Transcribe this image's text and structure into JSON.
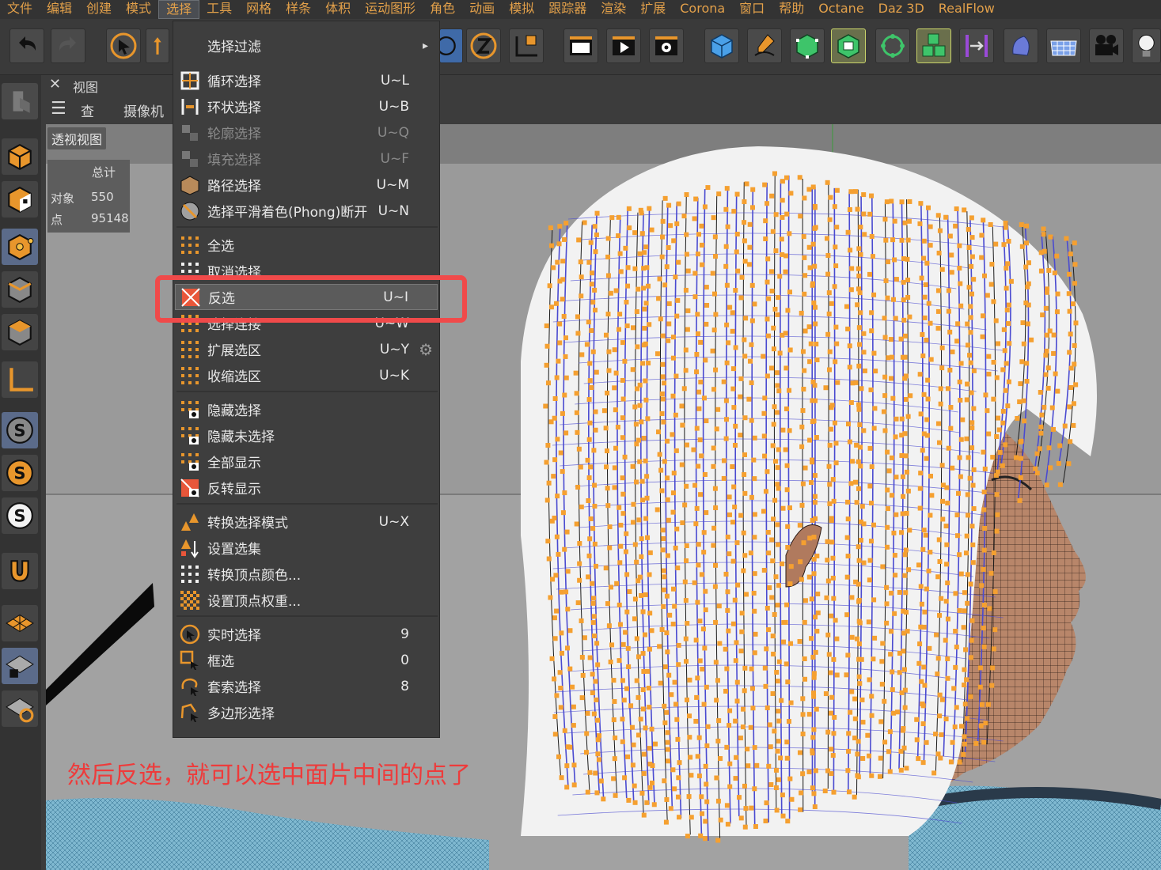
{
  "menubar": {
    "items": [
      "文件",
      "编辑",
      "创建",
      "模式",
      "选择",
      "工具",
      "网格",
      "样条",
      "体积",
      "运动图形",
      "角色",
      "动画",
      "模拟",
      "跟踪器",
      "渲染",
      "扩展",
      "Corona",
      "窗口",
      "帮助",
      "Octane",
      "Daz 3D",
      "RealFlow"
    ],
    "active": "选择"
  },
  "viewport": {
    "panel_title": "视图",
    "menu": [
      "查看",
      "摄像机"
    ],
    "label": "透视视图",
    "stats": {
      "header": "总计",
      "rows": [
        {
          "label": "对象",
          "value": "550"
        },
        {
          "label": "点",
          "value": "95148"
        }
      ]
    }
  },
  "dropdown": {
    "items": [
      {
        "label": "选择过滤",
        "shortcut": "",
        "submenu": true
      },
      {
        "label": "循环选择",
        "shortcut": "U~L"
      },
      {
        "label": "环状选择",
        "shortcut": "U~B"
      },
      {
        "label": "轮廓选择",
        "shortcut": "U~Q",
        "disabled": true
      },
      {
        "label": "填充选择",
        "shortcut": "U~F",
        "disabled": true
      },
      {
        "label": "路径选择",
        "shortcut": "U~M"
      },
      {
        "label": "选择平滑着色(Phong)断开",
        "shortcut": "U~N"
      },
      {
        "label": "全选",
        "shortcut": ""
      },
      {
        "label": "取消选择",
        "shortcut": ""
      },
      {
        "label": "反选",
        "shortcut": "U~I",
        "highlight": true
      },
      {
        "label": "选择连接",
        "shortcut": "U~W"
      },
      {
        "label": "扩展选区",
        "shortcut": "U~Y",
        "gear": true
      },
      {
        "label": "收缩选区",
        "shortcut": "U~K"
      },
      {
        "label": "隐藏选择",
        "shortcut": ""
      },
      {
        "label": "隐藏未选择",
        "shortcut": ""
      },
      {
        "label": "全部显示",
        "shortcut": ""
      },
      {
        "label": "反转显示",
        "shortcut": ""
      },
      {
        "label": "转换选择模式",
        "shortcut": "U~X"
      },
      {
        "label": "设置选集",
        "shortcut": ""
      },
      {
        "label": "转换顶点颜色...",
        "shortcut": ""
      },
      {
        "label": "设置顶点权重...",
        "shortcut": ""
      },
      {
        "label": "实时选择",
        "shortcut": "9"
      },
      {
        "label": "框选",
        "shortcut": "0"
      },
      {
        "label": "套索选择",
        "shortcut": "8"
      },
      {
        "label": "多边形选择",
        "shortcut": ""
      }
    ]
  },
  "annotation": "然后反选，就可以选中面片中间的点了",
  "colors": {
    "menu_text": "#e2a04a",
    "highlight_box": "#f04a4a",
    "annotation": "#ee3b3b",
    "vertex": "#f5a030",
    "wire": "#4a4ad0"
  }
}
